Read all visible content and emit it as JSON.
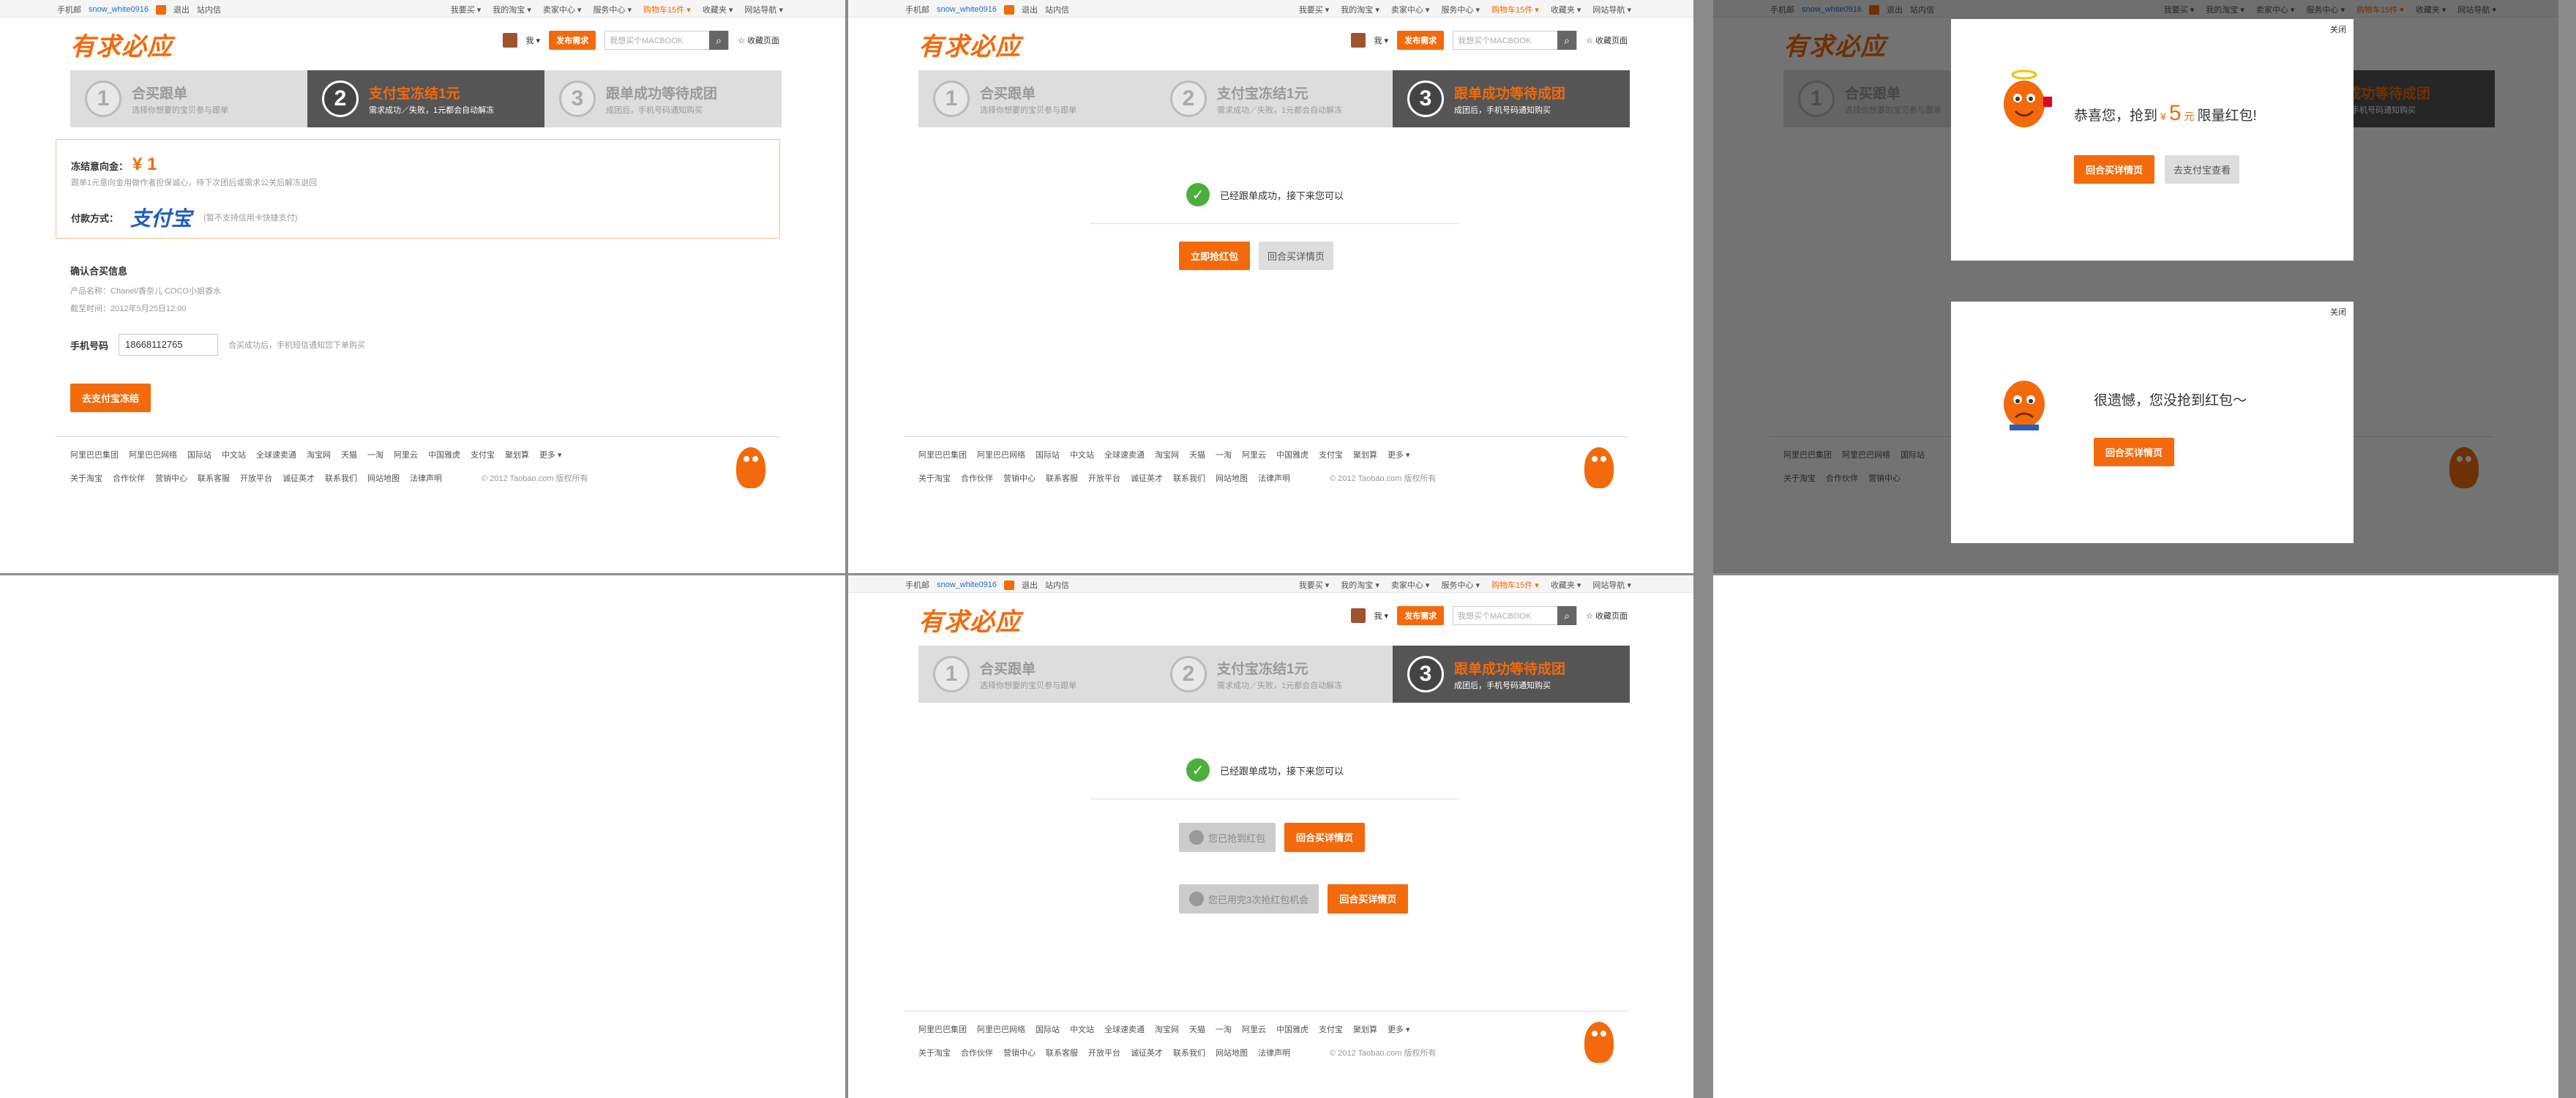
{
  "topbar": {
    "mobile": "手机邮",
    "user": "snow_white0916",
    "logout": "退出",
    "inbox": "站内信",
    "menu": [
      "我要买 ▾",
      "我的淘宝 ▾",
      "卖家中心 ▾",
      "服务中心 ▾"
    ],
    "cart": "购物车15件 ▾",
    "fav": "收藏夹 ▾",
    "sitenav": "网站导航 ▾"
  },
  "header": {
    "logo": "有求必应",
    "user_short": "我 ▾",
    "publish": "发布需求",
    "search_placeholder": "我想买个MACBOOK",
    "search_icon": "search-icon",
    "bookmark": "☆ 收藏页面"
  },
  "steps": [
    {
      "num": "1",
      "title": "合买跟单",
      "sub": "选择你想要的宝贝参与跟单"
    },
    {
      "num": "2",
      "title": "支付宝冻结1元",
      "sub": "需求成功／失败，1元都会自动解冻"
    },
    {
      "num": "3",
      "title": "跟单成功等待成团",
      "sub": "成团后，手机号码通知购买"
    }
  ],
  "pay": {
    "freeze_label": "冻结意向金：",
    "freeze_amount": "¥ 1",
    "freeze_note": "跟单1元意向金用做作者担保诚心，待下次团后或需求公关后解冻退回",
    "method_label": "付款方式：",
    "alipay": "支付宝",
    "alipay_note": "(暂不支持信用卡快捷支付)"
  },
  "confirm": {
    "title": "确认合买信息",
    "product_label": "产品名称：",
    "product": "Chanel/香奈儿 COCO小姐香水",
    "deadline_label": "截至时间：",
    "deadline": "2012年5月25日12:00"
  },
  "phone": {
    "label": "手机号码",
    "value": "18668112765",
    "note": "合买成功后，手机短信通知您下单购买"
  },
  "pay_button": "去支付宝冻结",
  "success": {
    "text": "已经跟单成功，接下来您可以",
    "grab": "立即抢红包",
    "back": "回合买详情页",
    "already": "您已抢到红包",
    "used_up": "您已用完3次抢红包机会"
  },
  "modal_win": {
    "close": "关闭",
    "pre": "恭喜您，抢到",
    "yen": "¥",
    "amount": "5",
    "unit": "元",
    "post": "限量红包!",
    "btn1": "回合买详情页",
    "btn2": "去支付宝查看"
  },
  "modal_lose": {
    "close": "关闭",
    "msg": "很遗憾，您没抢到红包～",
    "btn": "回合买详情页"
  },
  "footer": {
    "links": [
      "阿里巴巴集团",
      "阿里巴巴网络",
      "国际站",
      "中文站",
      "全球速卖通",
      "淘宝网",
      "天猫",
      "一淘",
      "阿里云",
      "中国雅虎",
      "支付宝",
      "聚划算",
      "更多 ▾"
    ],
    "links2": [
      "关于淘宝",
      "合作伙伴",
      "营销中心",
      "联系客服",
      "开放平台",
      "诚征英才",
      "联系我们",
      "网站地图",
      "法律声明"
    ],
    "copyright": "© 2012 Taobao.com 版权所有"
  },
  "colors": {
    "accent": "#f36a0c",
    "link": "#1f6fc4",
    "success": "#4caf3c"
  }
}
